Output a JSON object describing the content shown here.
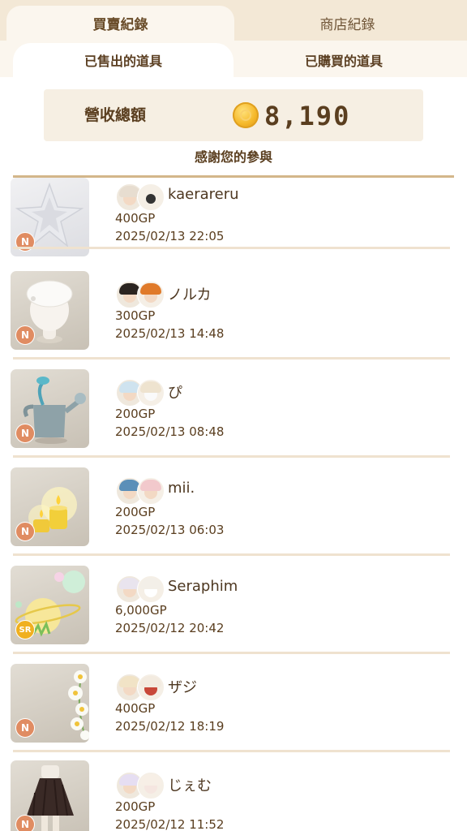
{
  "top_tabs": {
    "active": "買賣紀錄",
    "inactive": "商店紀錄"
  },
  "sub_tabs": {
    "active": "已售出的道具",
    "inactive": "已購買的道具"
  },
  "revenue": {
    "label": "營收總額",
    "value": "8,190",
    "icon": "gold-coin-icon"
  },
  "thanks": "感謝您的參與",
  "colors": {
    "accent": "#d3b68a",
    "rarity_n": "#e08c62",
    "rarity_sr": "#f0b020",
    "text": "#5a3e1f"
  },
  "sales": [
    {
      "seller": "kaerareru",
      "price": "400GP",
      "date": "2025/02/13 22:05",
      "rarity": "N",
      "item_icon": "white-star-rug-icon"
    },
    {
      "seller": "ノルカ",
      "price": "300GP",
      "date": "2025/02/13 14:48",
      "rarity": "N",
      "item_icon": "white-beret-icon"
    },
    {
      "seller": "ぴ",
      "price": "200GP",
      "date": "2025/02/13 08:48",
      "rarity": "N",
      "item_icon": "watering-can-icon"
    },
    {
      "seller": "mii.",
      "price": "200GP",
      "date": "2025/02/13 06:03",
      "rarity": "N",
      "item_icon": "candles-icon"
    },
    {
      "seller": "Seraphim",
      "price": "6,000GP",
      "date": "2025/02/12 20:42",
      "rarity": "SR",
      "item_icon": "planet-moon-icon"
    },
    {
      "seller": "ザジ",
      "price": "400GP",
      "date": "2025/02/12 18:19",
      "rarity": "N",
      "item_icon": "daisy-flowers-icon"
    },
    {
      "seller": "じぇむ",
      "price": "200GP",
      "date": "2025/02/12 11:52",
      "rarity": "N",
      "item_icon": "black-skirt-icon"
    }
  ]
}
